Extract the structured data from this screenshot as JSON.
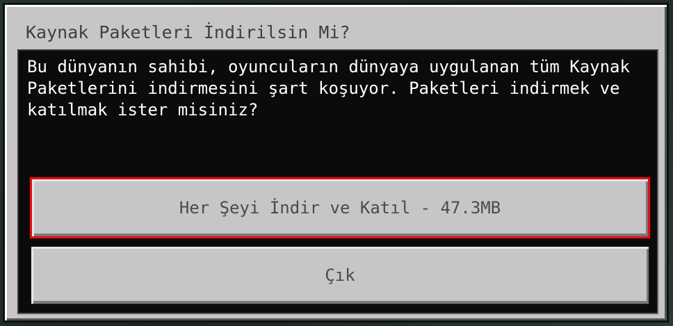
{
  "dialog": {
    "title": "Kaynak Paketleri İndirilsin Mi?",
    "message": "Bu dünyanın sahibi, oyuncuların dünyaya uygulanan tüm Kaynak Paketlerini indirmesini şart koşuyor. Paketleri indirmek ve katılmak ister misiniz?",
    "buttons": {
      "download_join": "Her Şeyi İndir ve Katıl - 47.3MB",
      "exit": "Çık"
    }
  },
  "colors": {
    "panel": "#c6c6c6",
    "content_bg": "#0b0b0b",
    "focus_border": "#e01010",
    "text_dark": "#3f3f3f",
    "text_light": "#ffffff"
  }
}
